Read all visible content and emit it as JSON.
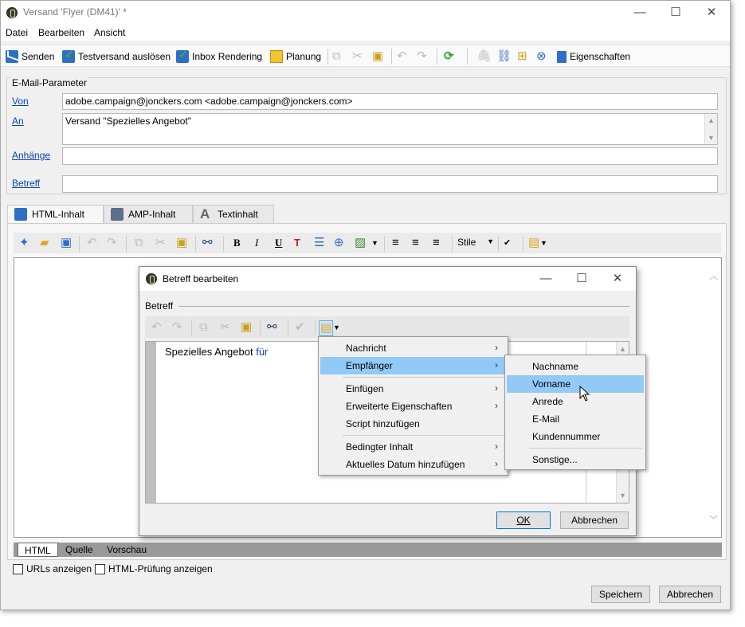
{
  "window": {
    "title": "Versand 'Flyer (DM41)' *"
  },
  "menu": [
    "Datei",
    "Bearbeiten",
    "Ansicht"
  ],
  "toolbar": {
    "send": "Senden",
    "test_send": "Testversand auslösen",
    "inbox_rendering": "Inbox Rendering",
    "planning": "Planung",
    "properties": "Eigenschaften"
  },
  "params": {
    "legend": "E-Mail-Parameter",
    "from_label": "Von",
    "from_value": "adobe.campaign@jonckers.com <adobe.campaign@jonckers.com>",
    "to_label": "An",
    "to_value": "Versand \"Spezielles Angebot\"",
    "attachments_label": "Anhänge",
    "attachments_value": "",
    "subject_label": "Betreff",
    "subject_value": ""
  },
  "tabs": [
    "HTML-Inhalt",
    "AMP-Inhalt",
    "Textinhalt"
  ],
  "editor": {
    "style_select": "Stile",
    "bottom_tabs": [
      "HTML",
      "Quelle",
      "Vorschau"
    ],
    "show_urls": "URLs anzeigen",
    "show_html_check": "HTML-Prüfung anzeigen"
  },
  "footer": {
    "save": "Speichern",
    "cancel": "Abbrechen"
  },
  "dialog": {
    "title": "Betreff bearbeiten",
    "group_label": "Betreff",
    "text_plain": "Spezielles Angebot ",
    "text_blue": "für",
    "ok": "OK",
    "cancel": "Abbrechen"
  },
  "context_menu": {
    "items": [
      "Nachricht",
      "Empfänger",
      "Einfügen",
      "Erweiterte Eigenschaften",
      "Script hinzufügen",
      "Bedingter Inhalt",
      "Aktuelles Datum hinzufügen"
    ],
    "highlighted": "Empfänger"
  },
  "submenu": {
    "items": [
      "Nachname",
      "Vorname",
      "Anrede",
      "E-Mail",
      "Kundennummer",
      "Sonstige..."
    ],
    "highlighted": "Vorname"
  },
  "colors": {
    "highlight": "#91c9f7",
    "link": "#0645ad",
    "accent_blue": "#2f6ec7"
  }
}
